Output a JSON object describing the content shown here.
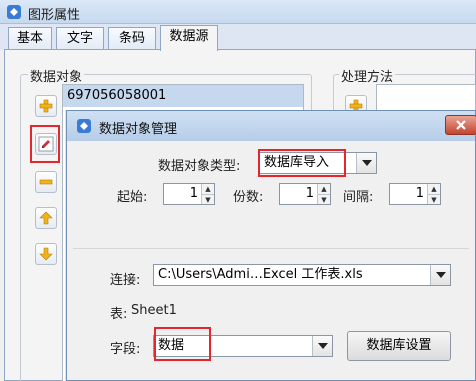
{
  "window": {
    "title": "图形属性"
  },
  "tabs": [
    {
      "label": "基本",
      "active": false
    },
    {
      "label": "文字",
      "active": false
    },
    {
      "label": "条码",
      "active": false
    },
    {
      "label": "数据源",
      "active": true
    }
  ],
  "data_objects": {
    "group_label": "数据对象",
    "items": [
      "697056058001"
    ],
    "buttons": [
      {
        "name": "add-button",
        "icon": "plus-icon"
      },
      {
        "name": "edit-button",
        "icon": "pencil-icon"
      },
      {
        "name": "remove-button",
        "icon": "minus-icon"
      },
      {
        "name": "move-up-button",
        "icon": "arrow-up-icon"
      },
      {
        "name": "move-down-button",
        "icon": "arrow-down-icon"
      }
    ]
  },
  "processing": {
    "group_label": "处理方法"
  },
  "dialog": {
    "title": "数据对象管理",
    "type_label": "数据对象类型:",
    "type_value": "数据库导入",
    "start_label": "起始:",
    "start_value": "1",
    "copies_label": "份数:",
    "copies_value": "1",
    "interval_label": "间隔:",
    "interval_value": "1",
    "connection_label": "连接:",
    "connection_value": "C:\\Users\\Admi…Excel 工作表.xls",
    "table_label": "表:",
    "table_value": "Sheet1",
    "field_label": "字段:",
    "field_value": "数据",
    "db_settings_button": "数据库设置"
  },
  "colors": {
    "highlight": "#e6262d",
    "selection": "#c5d8ee",
    "title_gradient": "#b6cde8",
    "close_red": "#c4442e"
  }
}
